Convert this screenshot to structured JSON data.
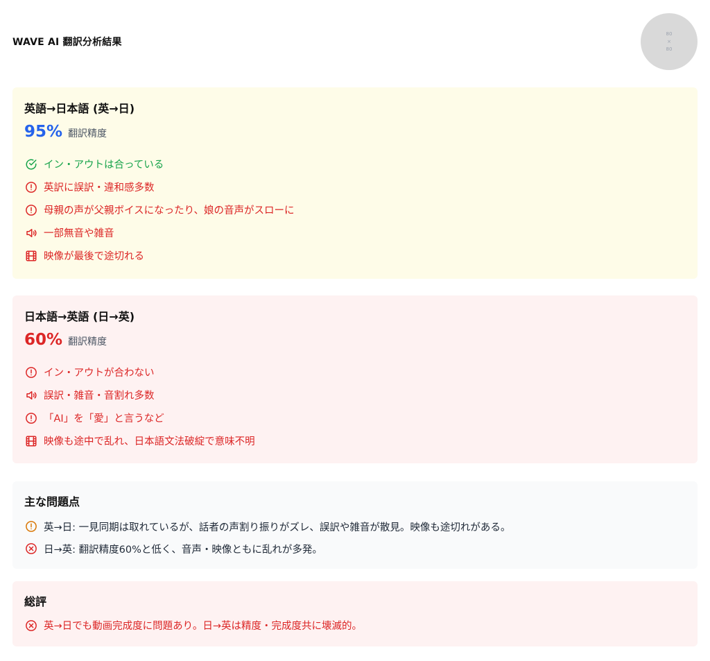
{
  "header": {
    "title": "WAVE AI 翻訳分析結果",
    "avatar_line1": "80",
    "avatar_line2": "×",
    "avatar_line3": "80"
  },
  "en_ja": {
    "title": "英語→日本語 (英→日)",
    "score": "95%",
    "score_label": "翻訳精度",
    "items": [
      {
        "icon": "check-circle-icon",
        "text": "イン・アウトは合っている"
      },
      {
        "icon": "alert-circle-icon",
        "text": "英訳に誤訳・違和感多数"
      },
      {
        "icon": "alert-circle-icon",
        "text": "母親の声が父親ボイスになったり、娘の音声がスローに"
      },
      {
        "icon": "speaker-icon",
        "text": "一部無音や雑音"
      },
      {
        "icon": "film-icon",
        "text": "映像が最後で途切れる"
      }
    ]
  },
  "ja_en": {
    "title": "日本語→英語 (日→英)",
    "score": "60%",
    "score_label": "翻訳精度",
    "items": [
      {
        "icon": "alert-circle-icon",
        "text": "イン・アウトが合わない"
      },
      {
        "icon": "speaker-icon",
        "text": "誤訳・雑音・音割れ多数"
      },
      {
        "icon": "alert-circle-icon",
        "text": "「AI」を「愛」と言うなど"
      },
      {
        "icon": "film-icon",
        "text": "映像も途中で乱れ、日本語文法破綻で意味不明"
      }
    ]
  },
  "issues": {
    "title": "主な問題点",
    "items": [
      {
        "icon": "alert-circle-icon",
        "text": "英→日: 一見同期は取れているが、話者の声割り振りがズレ、誤訳や雑音が散見。映像も途切れがある。"
      },
      {
        "icon": "x-circle-icon",
        "text": "日→英: 翻訳精度60%と低く、音声・映像ともに乱れが多発。"
      }
    ]
  },
  "summary": {
    "title": "総評",
    "items": [
      {
        "icon": "x-circle-icon",
        "text": "英→日でも動画完成度に問題あり。日→英は精度・完成度共に壊滅的。"
      }
    ]
  },
  "colors": {
    "green": "#16a34a",
    "red": "#dc2626",
    "blue": "#2563eb",
    "amber": "#d97706",
    "yellow_bg": "#fefce8",
    "red_bg": "#fef2f2",
    "gray_bg": "#f9fafb"
  }
}
